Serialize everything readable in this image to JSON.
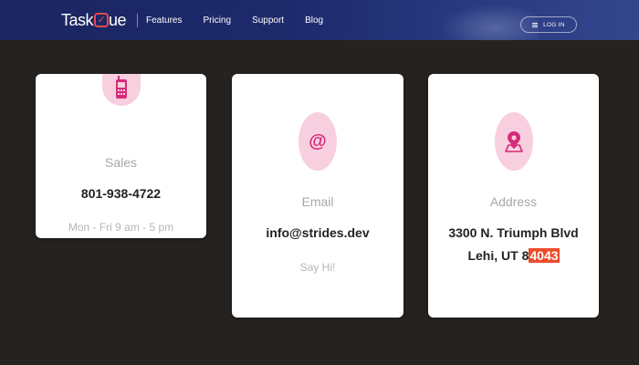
{
  "brand": {
    "logo_prefix": "Task",
    "logo_mark": "Q",
    "logo_suffix": "ue",
    "accent_color": "#e5484d"
  },
  "nav": {
    "links": [
      "Features",
      "Pricing",
      "Support",
      "Blog"
    ],
    "login_label": "LOG IN",
    "login_icon": "menu-icon"
  },
  "cards": {
    "sales": {
      "icon": "mobile-phone-icon",
      "label": "Sales",
      "value": "801-938-4722",
      "sub": "Mon - Fri 9 am - 5 pm"
    },
    "email": {
      "icon": "at-sign-icon",
      "label": "Email",
      "value": "info@strides.dev",
      "sub": "Say Hi!"
    },
    "address": {
      "icon": "map-pin-icon",
      "label": "Address",
      "line1": "3300 N. Triumph Blvd",
      "line2_prefix": "Lehi, UT 8",
      "line2_highlight": "4043",
      "highlight_color": "#ee4b2b"
    }
  },
  "colors": {
    "page_background": "#252220",
    "icon_circle": "#f8cfdf",
    "icon_glyph": "#d42b7a"
  }
}
